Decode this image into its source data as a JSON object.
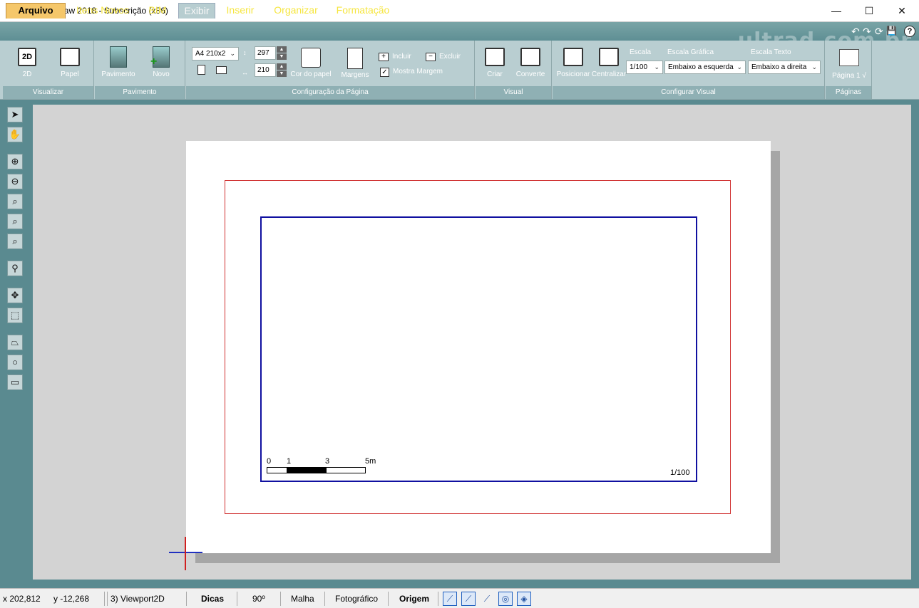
{
  "window": {
    "title": "AuE TopDraw 2018 - Subscrição (x86)",
    "minimize": "—",
    "maximize": "☐",
    "close": "✕"
  },
  "menu": {
    "tabs": [
      "Arquivo",
      "Itens Novos",
      "BIM",
      "Exibir",
      "Inserir",
      "Organizar",
      "Formatação"
    ],
    "selected": "Exibir"
  },
  "quick_access": [
    "↶",
    "↷",
    "⟳",
    "💾",
    "?"
  ],
  "watermark": "ultrad.com.br",
  "ribbon": {
    "visualizar": {
      "label": "Visualizar",
      "btn_2d": "2D",
      "btn_papel": "Papel"
    },
    "pavimento": {
      "label": "Pavimento",
      "btn_pavimento": "Pavimento",
      "btn_novo": "Novo"
    },
    "config_pagina": {
      "label": "Configuração da Página",
      "paper_size": "A4 210x2",
      "height": "297",
      "width": "210",
      "btn_cor": "Cor do papel",
      "btn_margens": "Margens",
      "btn_incluir": "Incluir",
      "btn_excluir": "Excluir",
      "chk_mostra_margem": "Mostra Margem"
    },
    "visual": {
      "label": "Visual",
      "btn_criar": "Criar",
      "btn_converte": "Converte"
    },
    "configurar_visual": {
      "label": "Configurar Visual",
      "btn_posicionar": "Posicionar",
      "btn_centralizar": "Centralizar",
      "escala_label": "Escala",
      "escala_value": "1/100",
      "escala_grafica_label": "Escala Gráfica",
      "escala_grafica_value": "Embaixo a esquerda",
      "escala_texto_label": "Escala Texto",
      "escala_texto_value": "Embaixo a direita"
    },
    "paginas": {
      "label": "Páginas",
      "btn_pagina": "Página 1 √"
    }
  },
  "drawing": {
    "scale_ticks": [
      "0",
      "1",
      "3",
      "5m"
    ],
    "scale_text": "1/100"
  },
  "status": {
    "x": "x 202,812",
    "y": "y -12,268",
    "viewport": "3) Viewport2D",
    "dicas": "Dicas",
    "angle": "90º",
    "malha": "Malha",
    "fotografico": "Fotográfico",
    "origem": "Origem"
  }
}
